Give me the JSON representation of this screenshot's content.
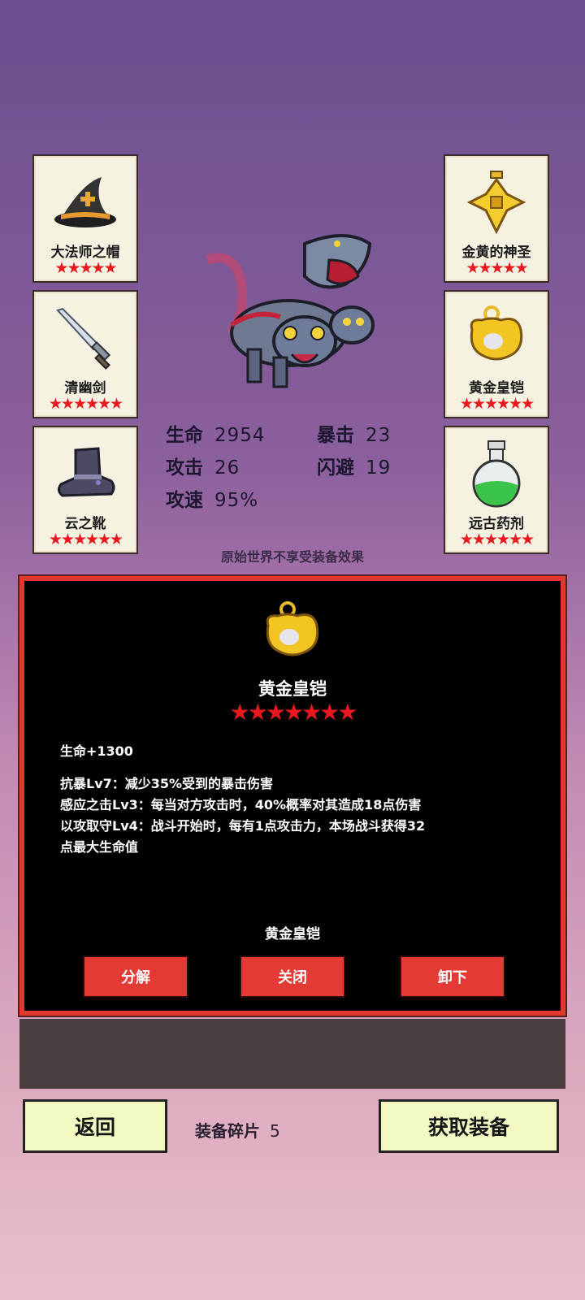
{
  "slots": [
    {
      "name": "大法师之帽",
      "stars": "★★★★★",
      "icon": "wizard-hat-icon"
    },
    {
      "name": "金黄的神圣",
      "stars": "★★★★★",
      "icon": "golden-cross-icon"
    },
    {
      "name": "清幽剑",
      "stars": "★★★★★★",
      "icon": "sword-icon"
    },
    {
      "name": "黄金皇铠",
      "stars": "★★★★★★",
      "icon": "golden-armor-icon"
    },
    {
      "name": "云之靴",
      "stars": "★★★★★★",
      "icon": "boots-icon"
    },
    {
      "name": "远古药剂",
      "stars": "★★★★★★",
      "icon": "potion-icon"
    }
  ],
  "stats": {
    "hp_label": "生命",
    "hp": "2954",
    "crit_label": "暴击",
    "crit": "23",
    "atk_label": "攻击",
    "atk": "26",
    "dodge_label": "闪避",
    "dodge": "19",
    "spd_label": "攻速",
    "spd": "95%"
  },
  "note": "原始世界不享受装备效果",
  "detail": {
    "title": "黄金皇铠",
    "stars": "★★★★★★★",
    "line1": "生命+1300",
    "line2": "抗暴Lv7：减少35%受到的暴击伤害",
    "line3": "感应之击Lv3：每当对方攻击时，40%概率对其造成18点伤害",
    "line4": "以攻取守Lv4：战斗开始时，每有1点攻击力，本场战斗获得32",
    "line5": "点最大生命值",
    "subtitle": "黄金皇铠",
    "btn_decompose": "分解",
    "btn_close": "关闭",
    "btn_unequip": "卸下"
  },
  "footer": {
    "back": "返回",
    "frag_label": "装备碎片",
    "frag_count": "5",
    "get": "获取装备"
  },
  "colors": {
    "star": "#e8191e",
    "panel_border": "#e2382e",
    "button": "#e43a36",
    "yellow_button": "#f3f7c2"
  }
}
